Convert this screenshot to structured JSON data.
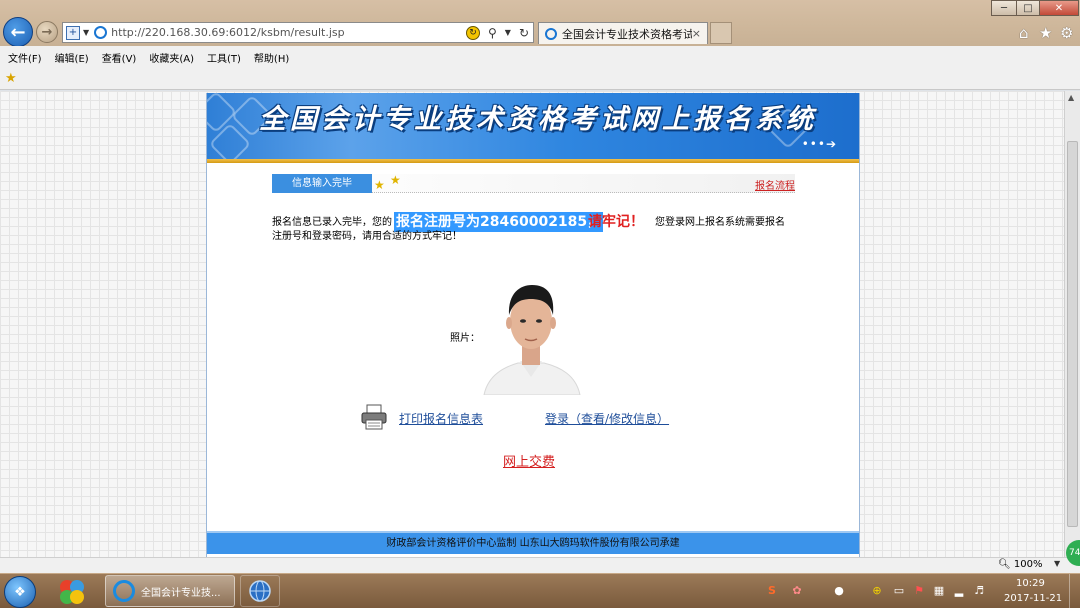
{
  "browser": {
    "url": "http://220.168.30.69:6012/ksbm/result.jsp",
    "tab_title": "全国会计专业技术资格考试...",
    "tab_close": "×",
    "menu": [
      "文件(F)",
      "编辑(E)",
      "查看(V)",
      "收藏夹(A)",
      "工具(T)",
      "帮助(H)"
    ],
    "zoom": "100%",
    "colors": {
      "chrome": "#cfb89c",
      "accent": "#1c5fb3"
    }
  },
  "page": {
    "banner_title": "全国会计专业技术资格考试网上报名系统",
    "banner_dots": "•••➔",
    "step_label": "信息输入完毕",
    "flow_link": "报名流程",
    "message": {
      "prefix": "报名信息已录入完毕，您的",
      "highlight": "报名注册号为28460002185，",
      "remember": "请牢记！",
      "tail": "您登录网上报名系统需要报名",
      "line2": "注册号和登录密码，请用合适的方式牢记！"
    },
    "photo_label": "照片：",
    "print_link": "打印报名信息表",
    "login_link": "登录（查看/修改信息）",
    "pay_link": "网上交费",
    "footer": "财政部会计资格评价中心监制      山东山大鸥玛软件股份有限公司承建",
    "colors": {
      "banner": "#2f86e0",
      "link": "#1f4e9a",
      "warn": "#d42020",
      "highlight": "#3399ff"
    }
  },
  "taskbar": {
    "ie_label": "全国会计专业技...",
    "time": "10:29",
    "date": "2017-11-21",
    "badge": "74"
  }
}
